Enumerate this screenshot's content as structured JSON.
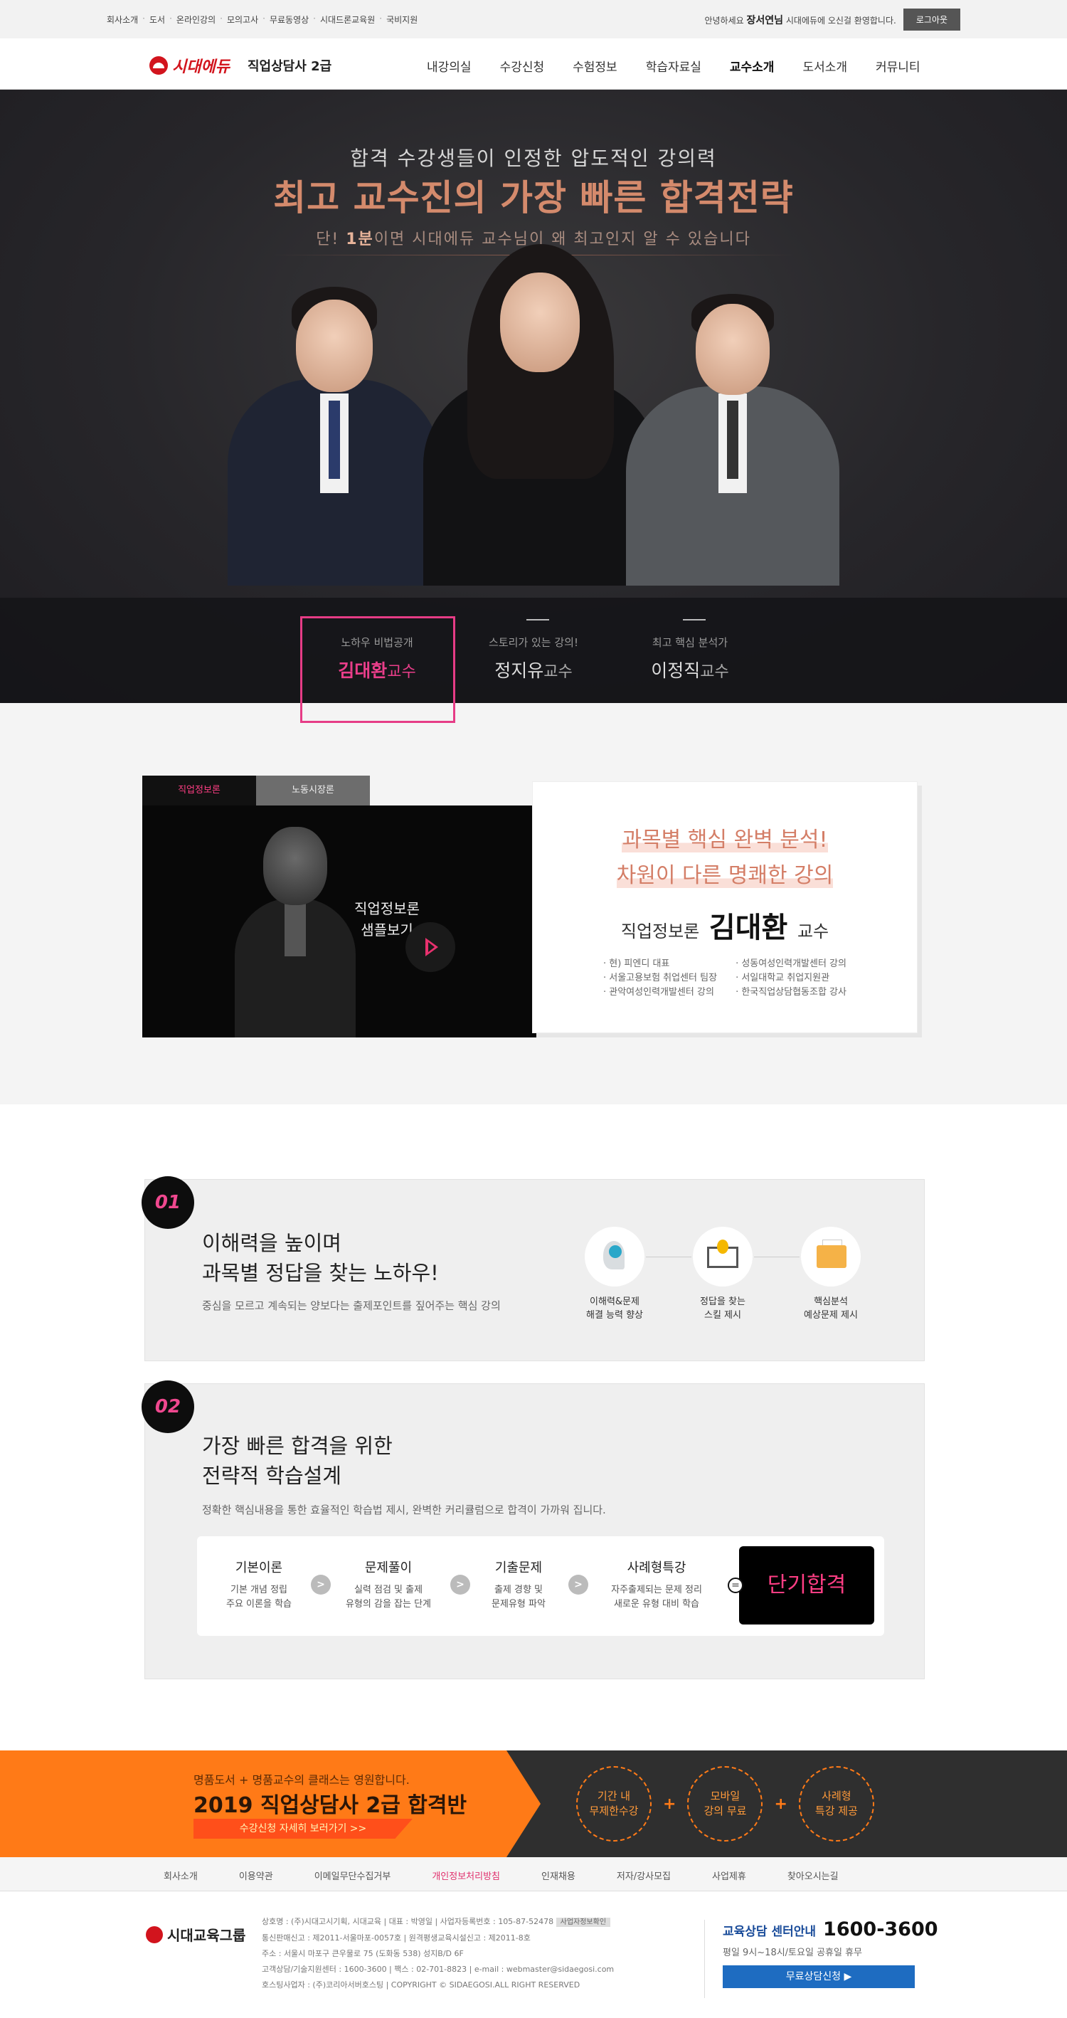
{
  "util": {
    "links": [
      "회사소개",
      "도서",
      "온라인강의",
      "모의고사",
      "무료동영상",
      "시대드론교육원",
      "국비지원"
    ],
    "greeting_pre": "안녕하세요",
    "user": "장서연님",
    "greeting_post": "시대에듀에 오신걸 환영합니다.",
    "logout": "로그아웃"
  },
  "gnb": {
    "brand": "시대에듀",
    "site": "직업상담사 2급",
    "menu": [
      "내강의실",
      "수강신청",
      "수험정보",
      "학습자료실",
      "교수소개",
      "도서소개",
      "커뮤니티"
    ],
    "active_index": 4
  },
  "hero": {
    "sub": "합격 수강생들이 인정한 압도적인 강의력",
    "title": "최고 교수진의 가장 빠른 합격전략",
    "desc_pre": "단! ",
    "desc_bold": "1분",
    "desc_post": "이면 시대에듀 교수님이 왜 최고인지 알 수 있습니다",
    "professors": [
      {
        "caption": "노하우 비법공개",
        "name": "김대환",
        "suffix": "교수"
      },
      {
        "caption": "스토리가 있는 강의!",
        "name": "정지유",
        "suffix": "교수"
      },
      {
        "caption": "최고 핵심 분석가",
        "name": "이정직",
        "suffix": "교수"
      }
    ]
  },
  "video": {
    "tabs": [
      "직업정보론",
      "노동시장론"
    ],
    "handwriting_1": "직업정보론",
    "handwriting_2": "샘플보기",
    "line1": "과목별 핵심 완벽 분석!",
    "line2": "차원이 다른 명쾌한 강의",
    "subject": "직업정보론",
    "prof_name": "김대환",
    "prof_suffix": "교수",
    "career_left": [
      "· 현) 피엔디 대표",
      "· 서울고용보험 취업센터 팀장",
      "· 관악여성인력개발센터 강의"
    ],
    "career_right": [
      "· 성동여성인력개발센터 강의",
      "· 서일대학교 취업지원관",
      "· 한국직업상담협동조합 강사"
    ]
  },
  "features": {
    "f1": {
      "num": "01",
      "title1": "이해력을 높이며",
      "title2": "과목별 정답을 찾는 노하우!",
      "desc": "중심을 모르고 계속되는 양보다는 출제포인트를 짚어주는 핵심 강의",
      "icons": [
        {
          "l1": "이해력&문제",
          "l2": "해결 능력 향상",
          "icon": "head-gear-icon"
        },
        {
          "l1": "정답을 찾는",
          "l2": "스킬 제시",
          "icon": "book-bulb-icon"
        },
        {
          "l1": "핵심분석",
          "l2": "예상문제 제시",
          "icon": "folder-icon"
        }
      ]
    },
    "f2": {
      "num": "02",
      "title1": "가장 빠른 합격을 위한",
      "title2": "전략적 학습설계",
      "desc": "정확한 핵심내용을 통한 효율적인 학습법 제시, 완벽한 커리큘럼으로 합격이 가까워 집니다.",
      "steps": [
        {
          "t": "기본이론",
          "d1": "기본 개념 정립",
          "d2": "주요 이론을 학습"
        },
        {
          "t": "문제풀이",
          "d1": "실력 점검 및 출제",
          "d2": "유형의 감을 잡는 단계"
        },
        {
          "t": "기출문제",
          "d1": "출제 경향 및",
          "d2": "문제유형 파악"
        },
        {
          "t": "사례형특강",
          "d1": "자주출제되는 문제 정리",
          "d2": "새로운 유형 대비 학습"
        }
      ],
      "arrow": ">",
      "eq": "=",
      "final": "단기합격"
    }
  },
  "banner": {
    "line1": "명품도서 + 명품교수의 클래스는 영원합니다.",
    "line2": "2019 직업상담사 2급 합격반",
    "cta": "수강신청 자세히 보러가기 >>",
    "circles": [
      {
        "l1": "기간 내",
        "l2": "무제한수강"
      },
      {
        "l1": "모바일",
        "l2": "강의 무료"
      },
      {
        "l1": "사례형",
        "l2": "특강 제공"
      }
    ],
    "plus": "+"
  },
  "footer": {
    "links": [
      "회사소개",
      "이용약관",
      "이메일무단수집거부",
      "개인정보처리방침",
      "인재채용",
      "저자/강사모집",
      "사업제휴",
      "찾아오시는길"
    ],
    "active_link": 3,
    "group": "시대교육그룹",
    "info": [
      "상호명 : (주)시대고시기획, 시대교육 | 대표 : 박영일 | 사업자등록번호 : 105-87-52478",
      "통신판매신고 : 제2011-서울마포-0057호 | 원격평생교육시설신고 : 제2011-8호",
      "주소 : 서울시 마포구 큰우물로 75 (도화동 538) 성지B/D 6F",
      "고객상담/기술지원센터 : 1600-3600 | 팩스 : 02-701-8823 | e-mail : webmaster@sidaegosi.com",
      "호스팅사업자 : (주)코리아서버호스팅 | COPYRIGHT © SIDAEGOSI.ALL RIGHT RESERVED"
    ],
    "badge": "사업자정보확인",
    "cs_title": "교육상담 센터안내",
    "cs_phone": "1600-3600",
    "cs_hours": "평일 9시~18시/토요일 공휴일 휴무",
    "cs_button": "무료상담신청 ▶"
  },
  "colors": {
    "accent_pink": "#e63c86",
    "brand_red": "#d2141d",
    "hero_title": "#d48a6c",
    "orange": "#ff7a17",
    "cs_blue": "#1e6cc1"
  }
}
